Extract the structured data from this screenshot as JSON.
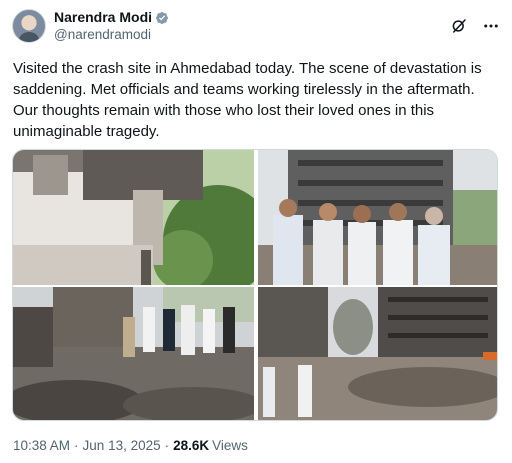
{
  "author": {
    "display_name": "Narendra Modi",
    "handle": "@narendramodi",
    "verified": true,
    "avatar_icon": "avatar-photo"
  },
  "header_icons": [
    "grok-icon",
    "more-icon"
  ],
  "tweet": {
    "text": "Visited the crash site in Ahmedabad today. The scene of devastation is saddening. Met officials and teams working tirelessly in the aftermath. Our thoughts remain with those who lost their loved ones in this unimaginable tragedy."
  },
  "media_count": 4,
  "meta": {
    "time": "10:38 AM",
    "separator": "·",
    "date": "Jun 13, 2025",
    "views_count": "28.6K",
    "views_label": "Views"
  },
  "colors": {
    "verified_badge": "#829aab",
    "secondary_text": "#536471",
    "primary_text": "#0f1419"
  }
}
